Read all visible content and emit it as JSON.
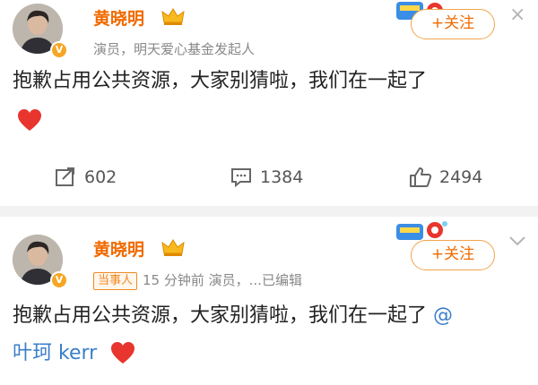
{
  "post1": {
    "author": "黄晓明",
    "meta": "演员，明天爱心基金发起人",
    "follow_label": "+关注",
    "close_label": "×",
    "text": "抱歉占用公共资源，大家别猜啦，我们在一起了",
    "actions": {
      "repost_count": "602",
      "comment_count": "1384",
      "like_count": "2494"
    }
  },
  "post2": {
    "author": "黄晓明",
    "tag": "当事人",
    "meta": "15 分钟前  演员，...已编辑",
    "follow_label": "+关注",
    "text": "抱歉占用公共资源，大家别猜啦，我们在一起了",
    "mention_at": "@",
    "mention_name": "叶珂 kerr"
  },
  "colors": {
    "accent": "#f06a00",
    "mention": "#3b7fc8",
    "heart": "#e8352e"
  },
  "icons": [
    "verified-badge-icon",
    "crown-icon",
    "close-icon",
    "chevron-down-icon",
    "repost-icon",
    "comment-icon",
    "like-icon",
    "heart-icon"
  ]
}
